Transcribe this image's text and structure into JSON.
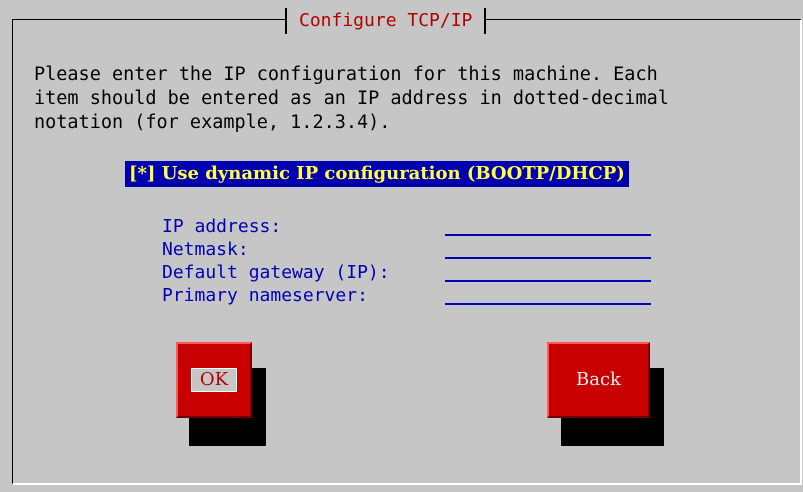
{
  "dialog": {
    "title": "Configure TCP/IP",
    "instructions": "Please enter the IP configuration for this machine. Each\nitem should be entered as an IP address in dotted-decimal\nnotation (for example, 1.2.3.4).",
    "dhcp_checkbox": {
      "label": "[*] Use dynamic IP configuration (BOOTP/DHCP)",
      "checked": true
    },
    "fields": [
      {
        "label": "IP address:",
        "value": ""
      },
      {
        "label": "Netmask:",
        "value": ""
      },
      {
        "label": "Default gateway (IP):",
        "value": ""
      },
      {
        "label": "Primary nameserver:",
        "value": ""
      }
    ],
    "buttons": {
      "ok": "OK",
      "back": "Back"
    }
  },
  "colors": {
    "background": "#c6c6c6",
    "title": "#b00000",
    "highlight_bg": "#0000b0",
    "highlight_text": "#ffff40",
    "label": "#0000b4",
    "button": "#c80000"
  }
}
